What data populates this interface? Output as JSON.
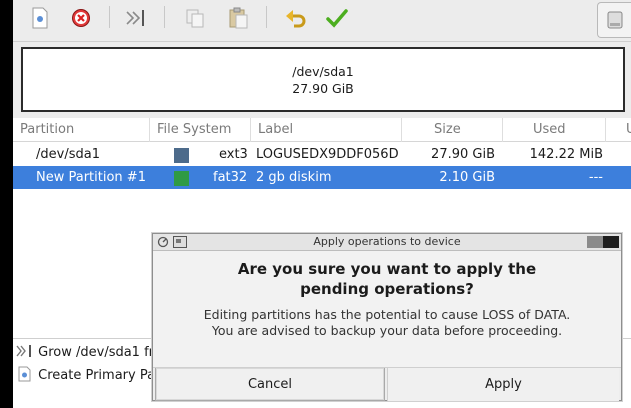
{
  "toolbar": {
    "icons": [
      "new-icon",
      "delete-icon",
      "resize-move-icon",
      "copy-icon",
      "paste-icon",
      "undo-icon",
      "apply-icon",
      "device-icon"
    ]
  },
  "disk": {
    "name": "/dev/sda1",
    "size": "27.90 GiB"
  },
  "table": {
    "headers": [
      "Partition",
      "File System",
      "Label",
      "Size",
      "Used",
      "U"
    ],
    "rows": [
      {
        "partition": "/dev/sda1",
        "fs": "ext3",
        "label": "LOGUSEDX9DDF056D",
        "size": "27.90 GiB",
        "used": "142.22 MiB",
        "fs_color": "#4d6b8b",
        "selected": false
      },
      {
        "partition": "New Partition #1",
        "fs": "fat32",
        "label": "2 gb diskim",
        "size": "2.10 GiB",
        "used": "---",
        "fs_color": "#2f9a45",
        "selected": true
      }
    ]
  },
  "operations": [
    {
      "text": "Grow /dev/sda1 fr",
      "icon": "resize-icon"
    },
    {
      "text": "Create Primary Pa",
      "icon": "new-partition-icon"
    }
  ],
  "dialog": {
    "title": "Apply operations to device",
    "primary_line1": "Are you sure you want to apply the",
    "primary_line2": "pending operations?",
    "secondary_line1": "Editing partitions has the potential to cause LOSS of DATA.",
    "secondary_line2": "You are advised to backup your data before proceeding.",
    "cancel_label": "Cancel",
    "apply_label": "Apply"
  }
}
